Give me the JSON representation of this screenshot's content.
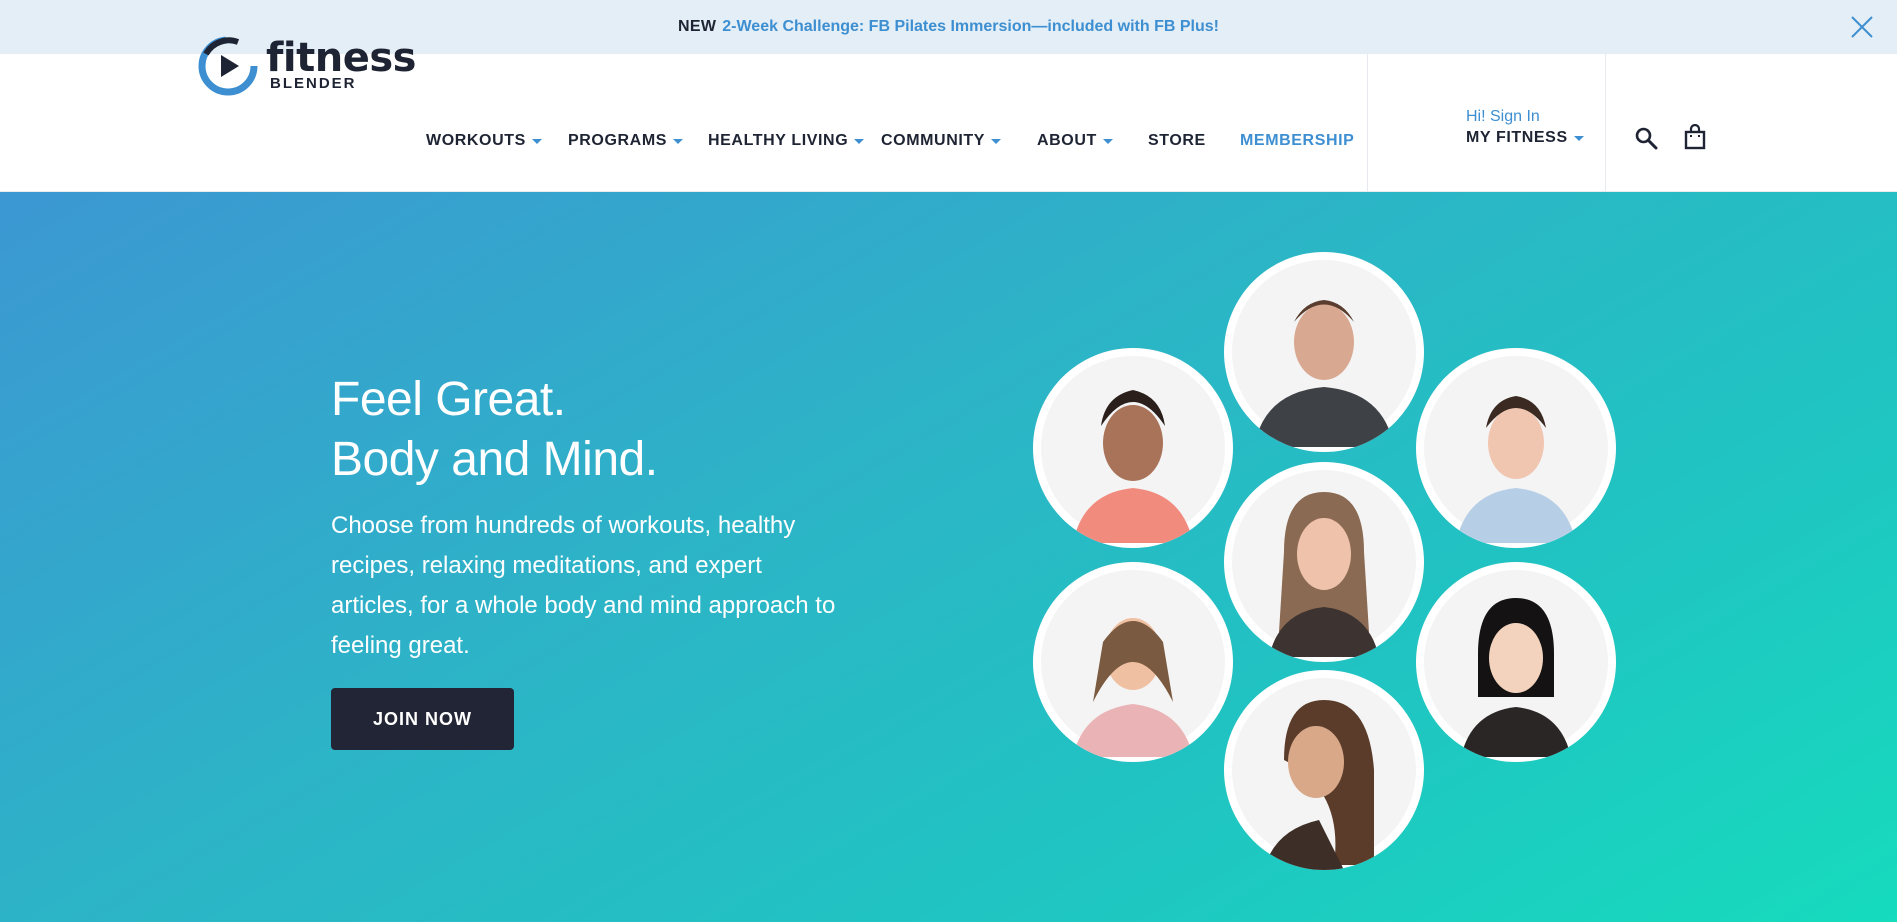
{
  "announcement": {
    "new_label": "NEW",
    "promo_text": "2-Week Challenge: FB Pilates Immersion—included with FB Plus!",
    "close_icon": "close-icon"
  },
  "logo": {
    "word": "fitness",
    "sub": "BLENDER",
    "icon": "play-circle-icon"
  },
  "nav": {
    "items": [
      {
        "label": "WORKOUTS",
        "dropdown": true
      },
      {
        "label": "PROGRAMS",
        "dropdown": true
      },
      {
        "label": "HEALTHY LIVING",
        "dropdown": true
      },
      {
        "label": "COMMUNITY",
        "dropdown": true
      },
      {
        "label": "ABOUT",
        "dropdown": true
      },
      {
        "label": "STORE",
        "dropdown": false
      },
      {
        "label": "MEMBERSHIP",
        "dropdown": false
      }
    ]
  },
  "account": {
    "greeting": "Hi! Sign In",
    "menu_label": "MY FITNESS"
  },
  "icons": {
    "search": "search-icon",
    "cart": "shopping-bag-icon"
  },
  "hero": {
    "title_line1": "Feel Great.",
    "title_line2": "Body and Mind.",
    "description": "Choose from hundreds of workouts, healthy recipes, relaxing meditations, and expert articles, for a whole body and mind approach to feeling great.",
    "cta_label": "JOIN NOW"
  },
  "colors": {
    "accent": "#3d8fd1",
    "dark": "#1e2433",
    "button": "#212536",
    "hero_gradient_start": "#3c97d3",
    "hero_gradient_end": "#16dbbd",
    "announce_bg": "#e4eef6"
  }
}
